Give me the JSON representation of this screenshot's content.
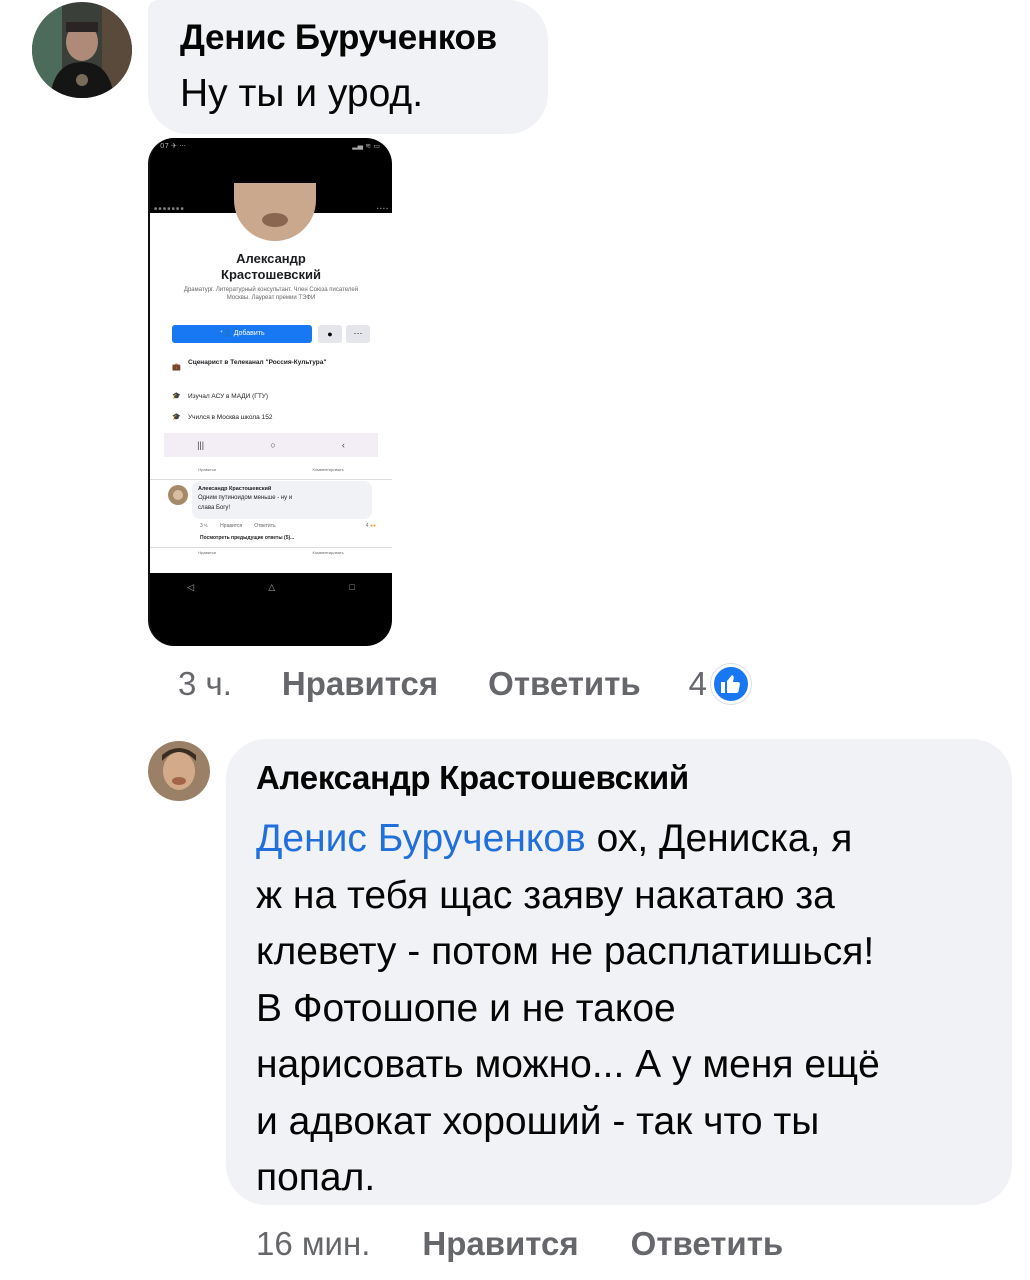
{
  "comment1": {
    "author": "Денис Бурученков",
    "text": "Ну ты и урод.",
    "screenshot": {
      "profile_name_line1": "Александр",
      "profile_name_line2": "Крастошевский",
      "profile_bio": "Драматург. Литературный консультант. Член Союза писателей Москвы. Лауреат премии ТЭФИ",
      "add_button": "Добавить",
      "info_items": [
        "Сценарист в Телеканал \"Россия-Культура\"",
        "Изучал АСУ в МАДИ (ГТУ)",
        "Учился в Москва школа 152"
      ],
      "like_label": "Нравится",
      "comment_label": "Комментировать",
      "embedded_comment_author": "Александр Крастошевский",
      "embedded_comment_text_line1": "Одним путиноидом меньше - ну и",
      "embedded_comment_text_line2": "слава Богу!",
      "embedded_time": "3 ч.",
      "embedded_like": "Нравится",
      "embedded_reply": "Ответить",
      "embedded_reactions": "4",
      "view_previous": "Посмотреть предыдущие ответы (5)..."
    },
    "time": "3 ч.",
    "like": "Нравится",
    "reply": "Ответить",
    "reaction_count": "4"
  },
  "comment2": {
    "author": "Александр Крастошевский",
    "mention": "Денис Бурученков",
    "text_line1": " ох, Дениска, я",
    "text_line2": "ж на тебя щас заяву накатаю за",
    "text_line3": "клевету - потом не расплатишься!",
    "text_line4": "В Фотошопе и не такое",
    "text_line5": "нарисовать можно... А у меня ещё",
    "text_line6": "и адвокат хороший - так что ты",
    "text_line7": "попал.",
    "time": "16 мин.",
    "like": "Нравится",
    "reply": "Ответить"
  },
  "colors": {
    "bubble": "#f0f2f5",
    "mention": "#216fdb",
    "meta": "#65676b",
    "like_blue": "#1877f2"
  }
}
